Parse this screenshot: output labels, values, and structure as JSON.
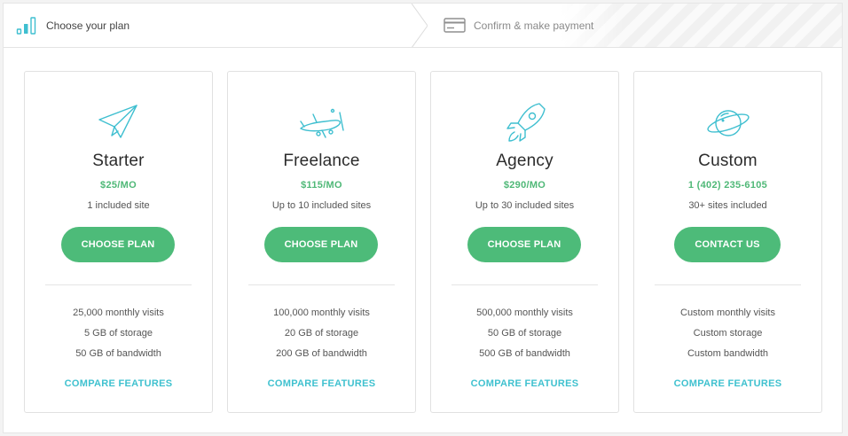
{
  "steps": [
    {
      "label": "Choose your plan",
      "icon": "bar-chart-icon",
      "active": true
    },
    {
      "label": "Confirm & make payment",
      "icon": "credit-card-icon",
      "active": false
    }
  ],
  "colors": {
    "accent_green": "#4dbb79",
    "accent_teal": "#3fc1cf",
    "price_green": "#4fb877"
  },
  "plans": [
    {
      "icon": "paper-plane-icon",
      "title": "Starter",
      "price": "$25/MO",
      "sites": "1 included site",
      "button": "CHOOSE PLAN",
      "features": [
        "25,000 monthly visits",
        "5 GB of storage",
        "50 GB of bandwidth"
      ],
      "compare": "COMPARE FEATURES"
    },
    {
      "icon": "propeller-plane-icon",
      "title": "Freelance",
      "price": "$115/MO",
      "sites": "Up to 10 included sites",
      "button": "CHOOSE PLAN",
      "features": [
        "100,000 monthly visits",
        "20 GB of storage",
        "200 GB of bandwidth"
      ],
      "compare": "COMPARE FEATURES"
    },
    {
      "icon": "rocket-icon",
      "title": "Agency",
      "price": "$290/MO",
      "sites": "Up to 30 included sites",
      "button": "CHOOSE PLAN",
      "features": [
        "500,000 monthly visits",
        "50 GB of storage",
        "500 GB of bandwidth"
      ],
      "compare": "COMPARE FEATURES"
    },
    {
      "icon": "planet-icon",
      "title": "Custom",
      "price": "1 (402) 235-6105",
      "sites": "30+ sites included",
      "button": "CONTACT US",
      "features": [
        "Custom monthly visits",
        "Custom storage",
        "Custom bandwidth"
      ],
      "compare": "COMPARE FEATURES"
    }
  ]
}
